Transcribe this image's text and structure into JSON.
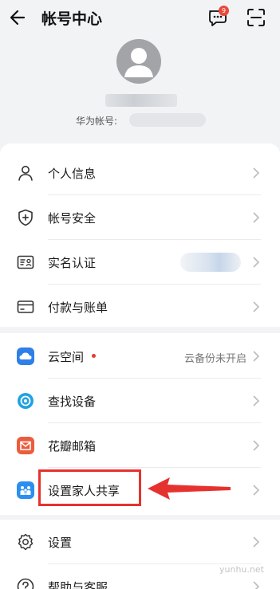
{
  "header": {
    "title": "帐号中心",
    "message_badge": "9",
    "account_label": "华为帐号:"
  },
  "card1": [
    {
      "label": "个人信息",
      "icon": "person-icon"
    },
    {
      "label": "帐号安全",
      "icon": "shield-icon"
    },
    {
      "label": "实名认证",
      "icon": "id-card-icon"
    },
    {
      "label": "付款与账单",
      "icon": "credit-card-icon"
    }
  ],
  "card2": [
    {
      "label": "云空间",
      "icon": "cloud-app-icon",
      "value": "云备份未开启"
    },
    {
      "label": "查找设备",
      "icon": "find-device-app-icon"
    },
    {
      "label": "花瓣邮箱",
      "icon": "petal-mail-app-icon"
    },
    {
      "label": "设置家人共享",
      "icon": "family-sharing-app-icon"
    }
  ],
  "card3": [
    {
      "label": "设置",
      "icon": "gear-icon"
    },
    {
      "label": "帮助与客服",
      "icon": "help-icon"
    }
  ],
  "watermark": "yunhu.net",
  "colors": {
    "background": "#f1f3f5",
    "badge": "#e84a3b",
    "highlight": "#e6322f",
    "cloud_icon": "#2f7fe8",
    "find_device_icon": "#1fa3e0",
    "mail_icon": "#ec5b3c",
    "family_icon": "#2a8ff0"
  }
}
